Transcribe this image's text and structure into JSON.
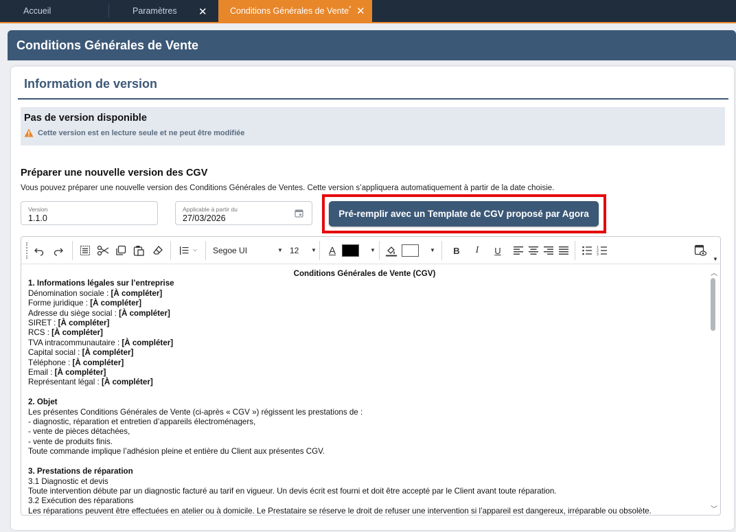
{
  "tabs": [
    {
      "label": "Accueil"
    },
    {
      "label": "Paramètres"
    },
    {
      "label": "Conditions Générales de Vente",
      "modified_marker": "*"
    }
  ],
  "page_title": "Conditions Générales de Vente",
  "section_title": "Information de version",
  "info_box": {
    "title": "Pas de version disponible",
    "warning": "Cette version est en lecture seule et ne peut être modifiée"
  },
  "prepare": {
    "title": "Préparer une nouvelle version des CGV",
    "description": "Vous pouvez préparer une nouvelle version des Conditions Générales de Ventes. Cette version s’appliquera automatiquement à partir de la date choisie."
  },
  "fields": {
    "version_label": "Version",
    "version_value": "1.1.0",
    "date_label": "Applicable à partir du",
    "date_value": "27/03/2026"
  },
  "prefill_button": "Pré-remplir avec un Template de CGV proposé par Agora",
  "toolbar": {
    "font": "Segoe UI",
    "size": "12",
    "bold": "B",
    "italic": "I",
    "underline": "U",
    "font_color_letter": "A",
    "font_color": "#000000",
    "highlight_color": "#ffffff"
  },
  "document": {
    "title": "Conditions Générales de Vente (CGV)",
    "s1_title": "1. Informations légales sur l’entreprise",
    "s1_lines": [
      {
        "label": "Dénomination sociale : ",
        "value": "[À compléter]"
      },
      {
        "label": "Forme juridique : ",
        "value": "[À compléter]"
      },
      {
        "label": "Adresse du siège social : ",
        "value": "[À compléter]"
      },
      {
        "label": "SIRET : ",
        "value": "[À compléter]"
      },
      {
        "label": "RCS : ",
        "value": "[À compléter]"
      },
      {
        "label": "TVA intracommunautaire : ",
        "value": "[À compléter]"
      },
      {
        "label": "Capital social : ",
        "value": "[À compléter]"
      },
      {
        "label": "Téléphone : ",
        "value": "[À compléter]"
      },
      {
        "label": "Email : ",
        "value": "[À compléter]"
      },
      {
        "label": "Représentant légal : ",
        "value": "[À compléter]"
      }
    ],
    "s2_title": "2. Objet",
    "s2_lines": [
      "Les présentes Conditions Générales de Vente (ci-après « CGV ») régissent les prestations de :",
      "- diagnostic, réparation et entretien d’appareils électroménagers,",
      "- vente de pièces détachées,",
      "- vente de produits finis.",
      "Toute commande implique l’adhésion pleine et entière du Client aux présentes CGV."
    ],
    "s3_title": "3. Prestations de réparation",
    "s3_lines": [
      "3.1 Diagnostic et devis",
      "Toute intervention débute par un diagnostic facturé au tarif en vigueur. Un devis écrit est fourni et doit être accepté par le Client avant toute réparation.",
      "3.2 Exécution des réparations",
      "Les réparations peuvent être effectuées en atelier ou à domicile. Le Prestataire se réserve le droit de refuser une intervention si l’appareil est dangereux, irréparable ou obsolète."
    ]
  }
}
